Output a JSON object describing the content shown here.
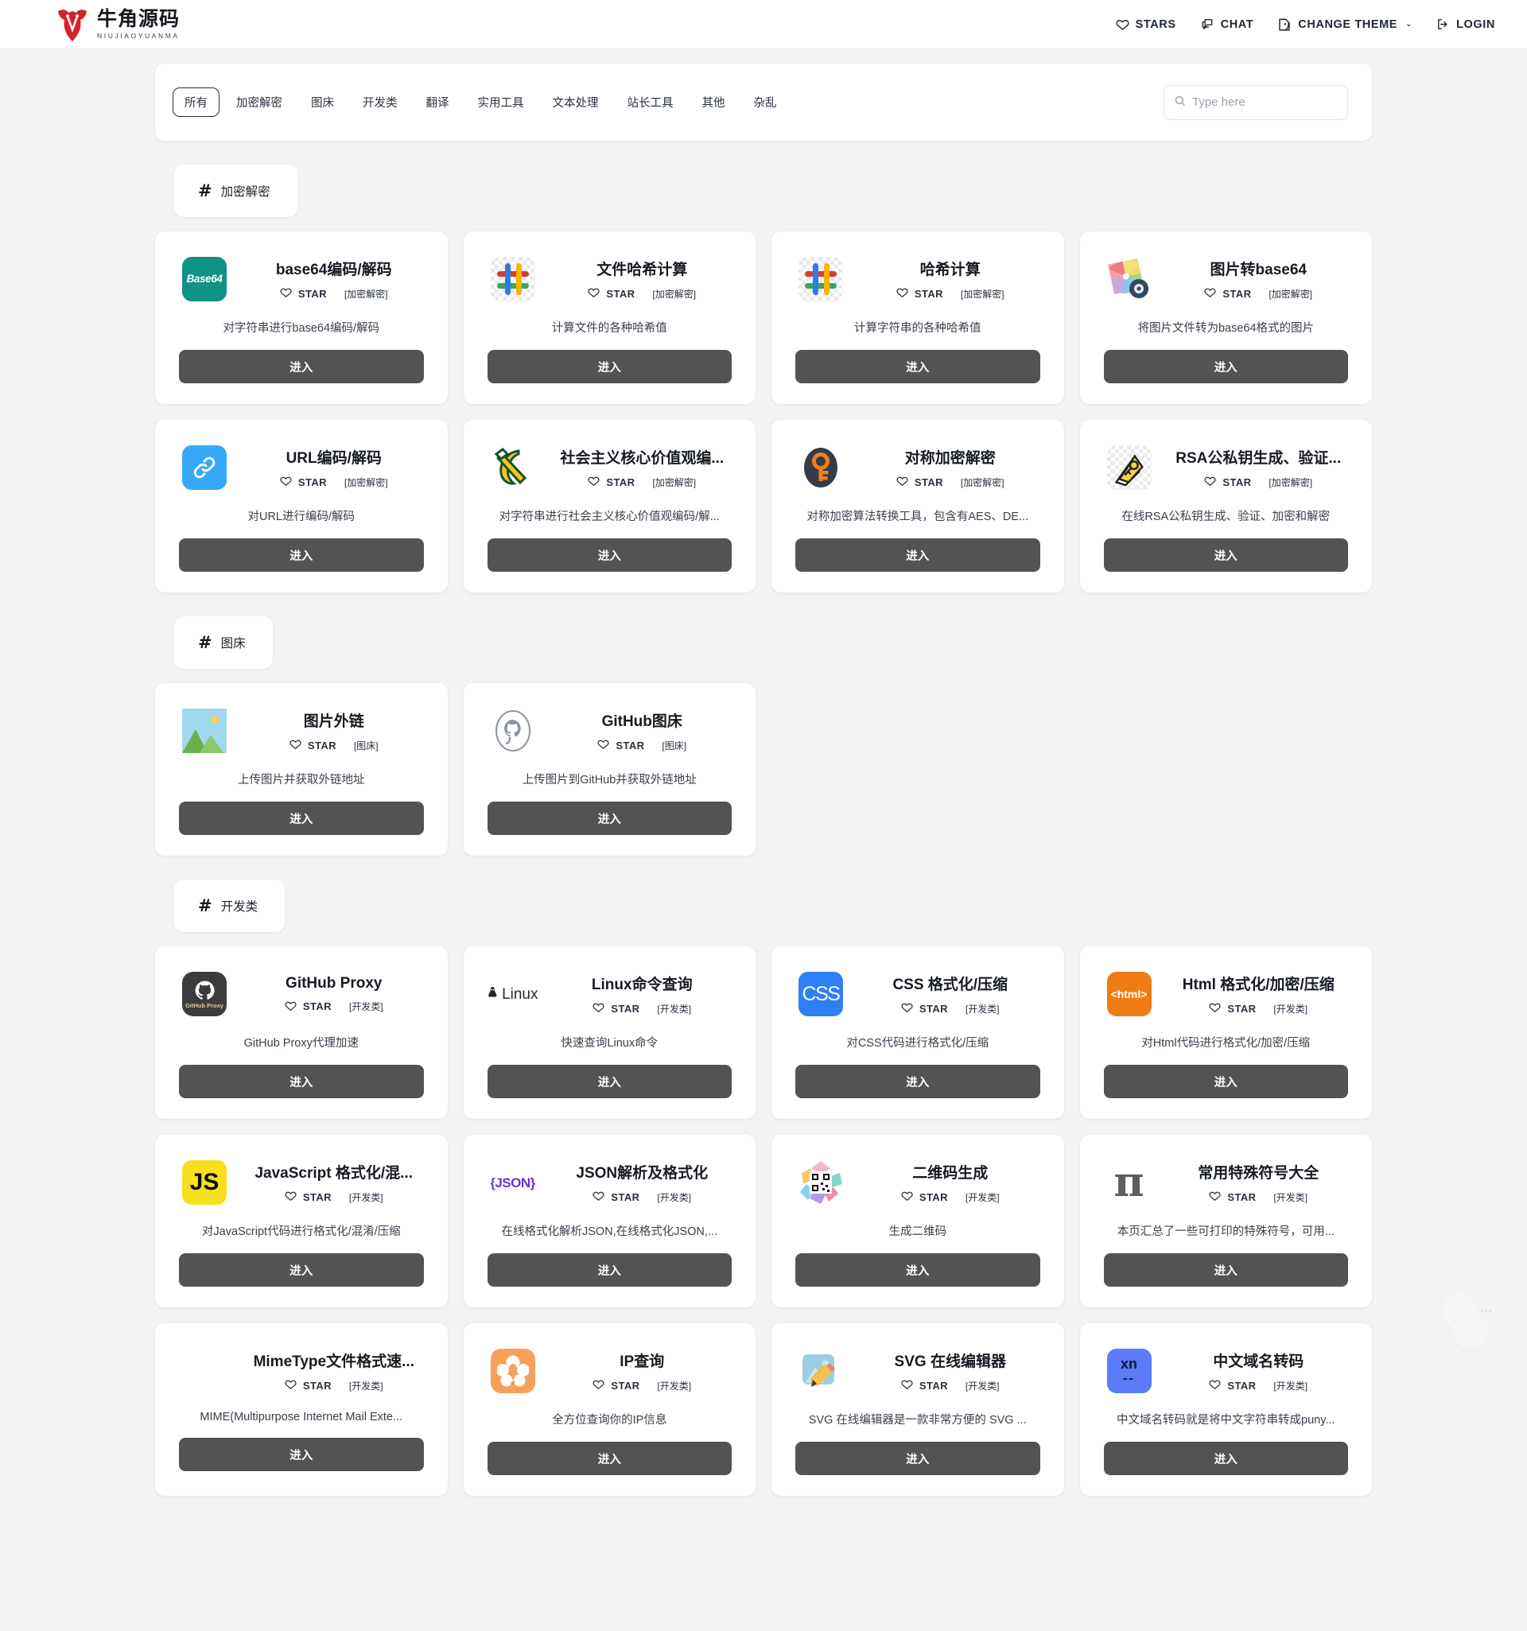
{
  "header": {
    "brand": {
      "cn": "牛角源码",
      "en": "NIUJIAOYUANMA",
      "logo_icon": "bull-head-logo",
      "logo_color": "#d6222a"
    },
    "nav": [
      {
        "label": "STARS",
        "icon": "heart-icon"
      },
      {
        "label": "CHAT",
        "icon": "chat-bubble-icon"
      },
      {
        "label": "CHANGE THEME",
        "icon": "theme-palette-icon",
        "caret": "⌄"
      },
      {
        "label": "LOGIN",
        "icon": "login-arrow-icon"
      }
    ]
  },
  "filter": {
    "tabs": [
      {
        "label": "所有",
        "active": true
      },
      {
        "label": "加密解密",
        "active": false
      },
      {
        "label": "图床",
        "active": false
      },
      {
        "label": "开发类",
        "active": false
      },
      {
        "label": "翻译",
        "active": false
      },
      {
        "label": "实用工具",
        "active": false
      },
      {
        "label": "文本处理",
        "active": false
      },
      {
        "label": "站长工具",
        "active": false
      },
      {
        "label": "其他",
        "active": false
      },
      {
        "label": "杂乱",
        "active": false
      }
    ],
    "search": {
      "placeholder": "Type here",
      "value": "",
      "icon": "search-icon"
    }
  },
  "labels": {
    "hash": "#",
    "star": "STAR",
    "enter": "进入",
    "star_icon": "heart-outline-icon"
  },
  "sections": [
    {
      "title": "加密解密",
      "cards": [
        {
          "title": "base64编码/解码",
          "category": "[加密解密]",
          "desc": "对字符串进行base64编码/解码",
          "icon": "base64-icon",
          "icon_text": "Base64"
        },
        {
          "title": "文件哈希计算",
          "category": "[加密解密]",
          "desc": "计算文件的各种哈希值",
          "icon": "hash-colored-icon",
          "icon_text": ""
        },
        {
          "title": "哈希计算",
          "category": "[加密解密]",
          "desc": "计算字符串的各种哈希值",
          "icon": "hash-colored-icon",
          "icon_text": ""
        },
        {
          "title": "图片转base64",
          "category": "[加密解密]",
          "desc": "将图片文件转为base64格式的图片",
          "icon": "color-wheel-photo-icon",
          "icon_text": ""
        },
        {
          "title": "URL编码/解码",
          "category": "[加密解密]",
          "desc": "对URL进行编码/解码",
          "icon": "link-chain-icon",
          "icon_text": ""
        },
        {
          "title": "社会主义核心价值观编...",
          "category": "[加密解密]",
          "desc": "对字符串进行社会主义核心价值观编码/解...",
          "icon": "hammer-sickle-icon",
          "icon_text": ""
        },
        {
          "title": "对称加密解密",
          "category": "[加密解密]",
          "desc": "对称加密算法转换工具，包含有AES、DE...",
          "icon": "key-circle-icon",
          "icon_text": ""
        },
        {
          "title": "RSA公私钥生成、验证...",
          "category": "[加密解密]",
          "desc": "在线RSA公私钥生成、验证、加密和解密",
          "icon": "key-tag-icon",
          "icon_text": ""
        }
      ]
    },
    {
      "title": "图床",
      "cards": [
        {
          "title": "图片外链",
          "category": "[图床]",
          "desc": "上传图片并获取外链地址",
          "icon": "picture-mountain-icon",
          "icon_text": ""
        },
        {
          "title": "GitHub图床",
          "category": "[图床]",
          "desc": "上传图片到GitHub并获取外链地址",
          "icon": "github-octocat-icon",
          "icon_text": ""
        }
      ]
    },
    {
      "title": "开发类",
      "cards": [
        {
          "title": "GitHub Proxy",
          "category": "[开发类]",
          "desc": "GitHub Proxy代理加速",
          "icon": "github-proxy-icon",
          "icon_text": "GitHub Proxy"
        },
        {
          "title": "Linux命令查询",
          "category": "[开发类]",
          "desc": "快速查询Linux命令",
          "icon": "linux-penguin-icon",
          "icon_text": "Linux"
        },
        {
          "title": "CSS 格式化/压缩",
          "category": "[开发类]",
          "desc": "对CSS代码进行格式化/压缩",
          "icon": "css-icon",
          "icon_text": "CSS"
        },
        {
          "title": "Html 格式化/加密/压缩",
          "category": "[开发类]",
          "desc": "对Html代码进行格式化/加密/压缩",
          "icon": "html-tag-icon",
          "icon_text": "<html>"
        },
        {
          "title": "JavaScript 格式化/混...",
          "category": "[开发类]",
          "desc": "对JavaScript代码进行格式化/混淆/压缩",
          "icon": "javascript-icon",
          "icon_text": "JS"
        },
        {
          "title": "JSON解析及格式化",
          "category": "[开发类]",
          "desc": "在线格式化解析JSON,在线格式化JSON,...",
          "icon": "json-icon",
          "icon_text": "{JSON}"
        },
        {
          "title": "二维码生成",
          "category": "[开发类]",
          "desc": "生成二维码",
          "icon": "qrcode-icon",
          "icon_text": ""
        },
        {
          "title": "常用特殊符号大全",
          "category": "[开发类]",
          "desc": "本页汇总了一些可打印的特殊符号，可用...",
          "icon": "pi-symbol-icon",
          "icon_text": "π"
        },
        {
          "title": "MimeType文件格式速...",
          "category": "[开发类]",
          "desc": "MIME(Multipurpose Internet Mail Exte...",
          "icon": "mime-grid-icon",
          "icon_text": ""
        },
        {
          "title": "IP查询",
          "category": "[开发类]",
          "desc": "全方位查询你的IP信息",
          "icon": "ip-flower-icon",
          "icon_text": ""
        },
        {
          "title": "SVG 在线编辑器",
          "category": "[开发类]",
          "desc": "SVG 在线编辑器是一款非常方便的 SVG ...",
          "icon": "svg-edit-icon",
          "icon_text": ""
        },
        {
          "title": "中文域名转码",
          "category": "[开发类]",
          "desc": "中文域名转码就是将中文字符串转成puny...",
          "icon": "punycode-xn-icon",
          "icon_text": "xn"
        }
      ]
    }
  ],
  "colors": {
    "page_bg": "#f2f3f5",
    "card_bg": "#ffffff",
    "button_bg": "#535353",
    "text": "#1f2430",
    "brand_red": "#d6222a"
  }
}
